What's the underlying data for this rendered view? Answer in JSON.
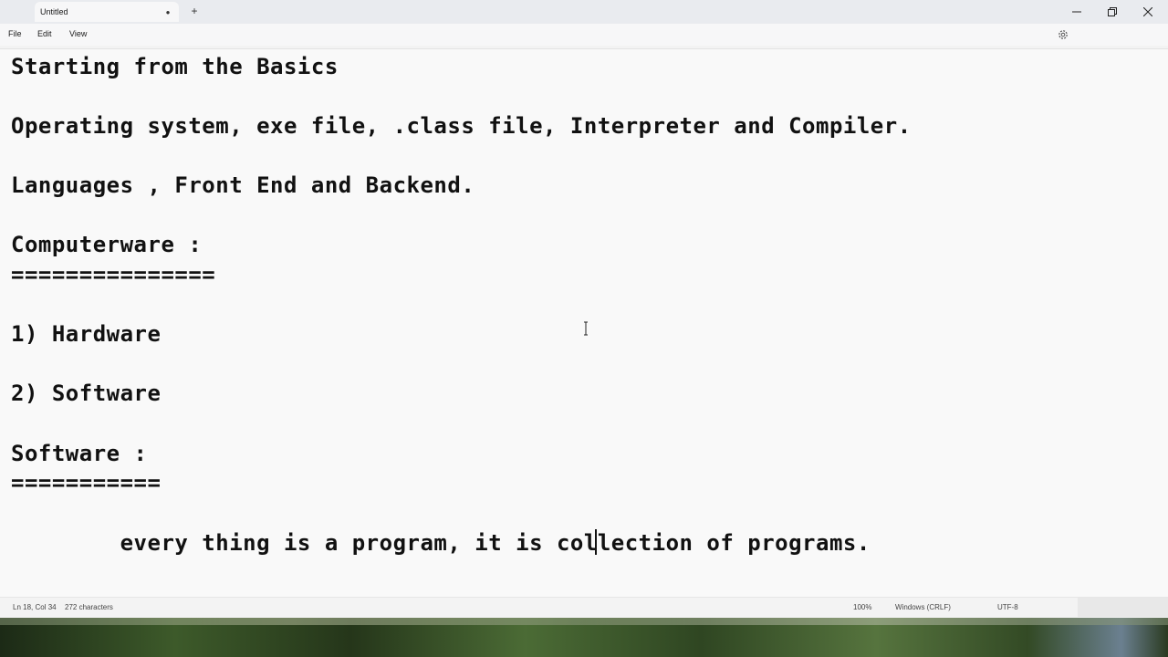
{
  "window": {
    "tab_title": "Untitled",
    "tab_modified_dot": "●",
    "new_tab": "+",
    "minimize": "—",
    "maximize": "❐",
    "close": "✕"
  },
  "menu": {
    "file": "File",
    "edit": "Edit",
    "view": "View",
    "settings_icon": "gear-icon"
  },
  "document": {
    "lines": [
      "Starting from the Basics",
      "Operating system, exe file, .class file, Interpreter and Compiler.",
      "Languages , Front End and Backend.",
      "Computerware :",
      "===============",
      "1) Hardware",
      "2) Software",
      "Software :",
      "===========",
      "        every thing is a program, it is collection of programs."
    ]
  },
  "status": {
    "position": "Ln 18, Col 34",
    "characters": "272 characters",
    "zoom": "100%",
    "line_ending": "Windows (CRLF)",
    "encoding": "UTF-8"
  }
}
